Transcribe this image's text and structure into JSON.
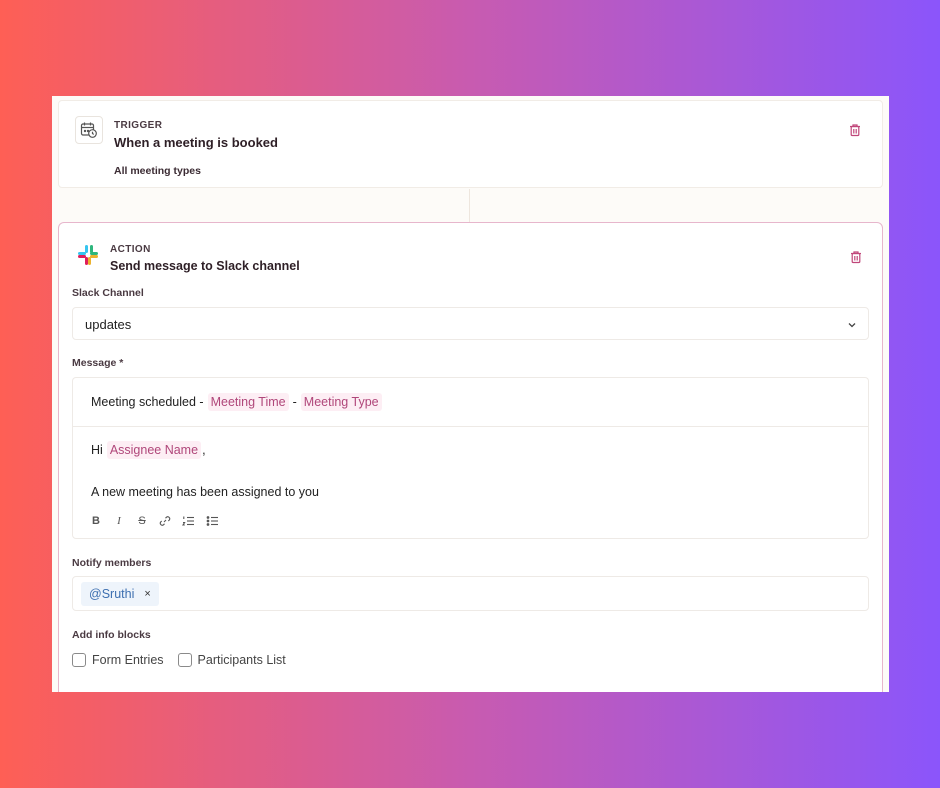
{
  "trigger": {
    "eyebrow": "TRIGGER",
    "title": "When a meeting is booked",
    "subtitle": "All meeting types",
    "icon": "calendar-clock-icon"
  },
  "action": {
    "eyebrow": "ACTION",
    "title": "Send message to Slack channel",
    "icon": "slack-icon",
    "slack_channel_label": "Slack Channel",
    "slack_channel_value": "updates",
    "message_label": "Message *",
    "message": {
      "subject_text": "Meeting scheduled -",
      "subject_tag_1": "Meeting Time",
      "subject_sep": "-",
      "subject_tag_2": "Meeting Type",
      "greeting": "Hi",
      "greeting_tag": "Assignee Name",
      "greeting_comma": ",",
      "body": "A new meeting has been assigned to you"
    },
    "toolbar": {
      "bold": "B",
      "italic": "I",
      "strike": "S"
    },
    "notify_label": "Notify members",
    "notify_member": "@Sruthi",
    "notify_remove": "×",
    "info_blocks_label": "Add info blocks",
    "info_blocks": [
      {
        "label": "Form Entries",
        "checked": false
      },
      {
        "label": "Participants List",
        "checked": false
      }
    ]
  },
  "colors": {
    "accent": "#b0477a",
    "tag_bg": "#fdeef4",
    "chip_bg": "#eef4fb",
    "chip_text": "#3d6fb0",
    "trash": "#c0467a"
  }
}
